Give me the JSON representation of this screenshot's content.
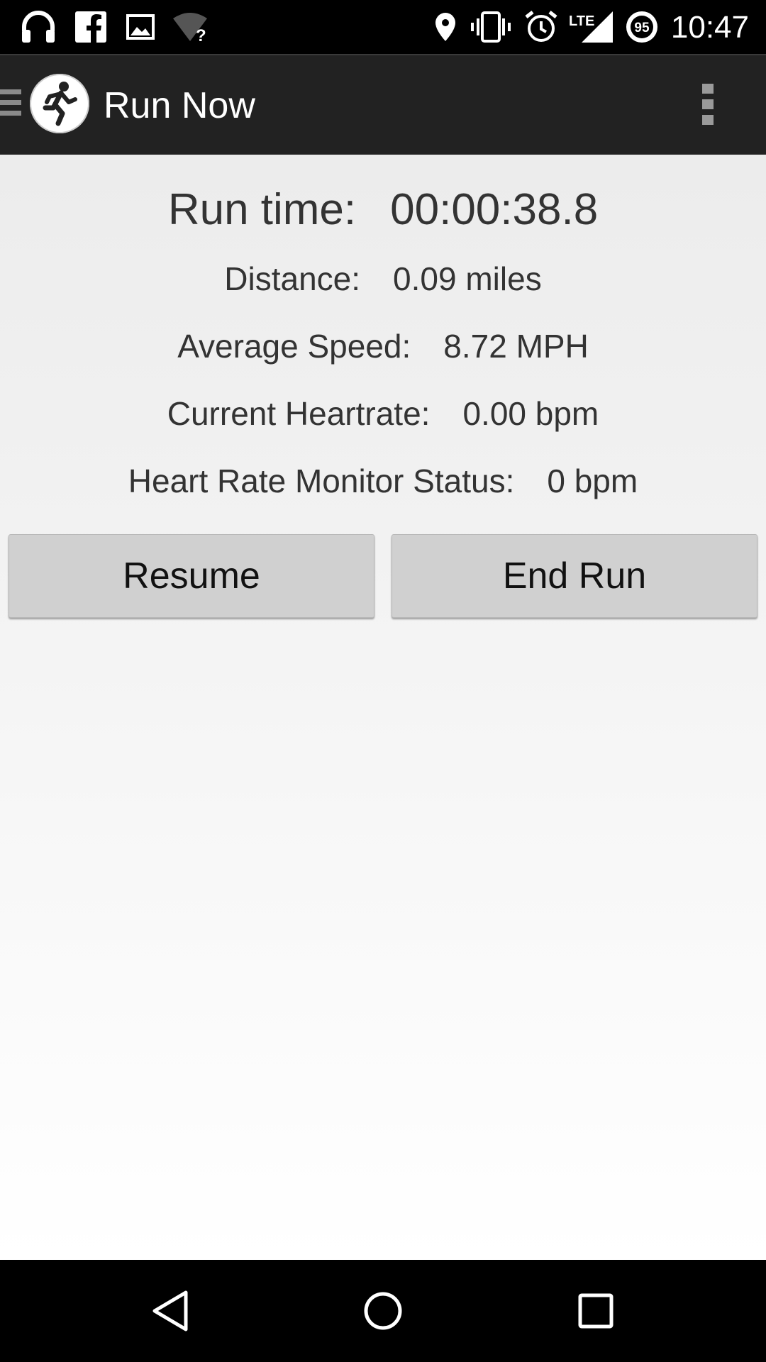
{
  "status_bar": {
    "time": "10:47",
    "battery_level": "95",
    "network_label": "LTE",
    "icons": [
      "headphones-icon",
      "facebook-icon",
      "image-icon",
      "wifi-unknown-icon",
      "location-icon",
      "vibrate-icon",
      "alarm-icon",
      "signal-lte-icon",
      "battery-icon"
    ]
  },
  "action_bar": {
    "title": "Run Now",
    "icons": [
      "drawer-icon",
      "runner-logo-icon",
      "overflow-menu-icon"
    ]
  },
  "stats": {
    "run_time_label": "Run time:",
    "run_time_value": "00:00:38.8",
    "distance_label": "Distance:",
    "distance_value": "0.09 miles",
    "avg_speed_label": "Average Speed:",
    "avg_speed_value": "8.72 MPH",
    "heartrate_label": "Current Heartrate:",
    "heartrate_value": "0.00 bpm",
    "hrm_status_label": "Heart Rate Monitor Status:",
    "hrm_status_value": "0 bpm"
  },
  "buttons": {
    "resume": "Resume",
    "end_run": "End Run"
  },
  "nav_bar": {
    "icons": [
      "back-icon",
      "home-icon",
      "recents-icon"
    ]
  }
}
